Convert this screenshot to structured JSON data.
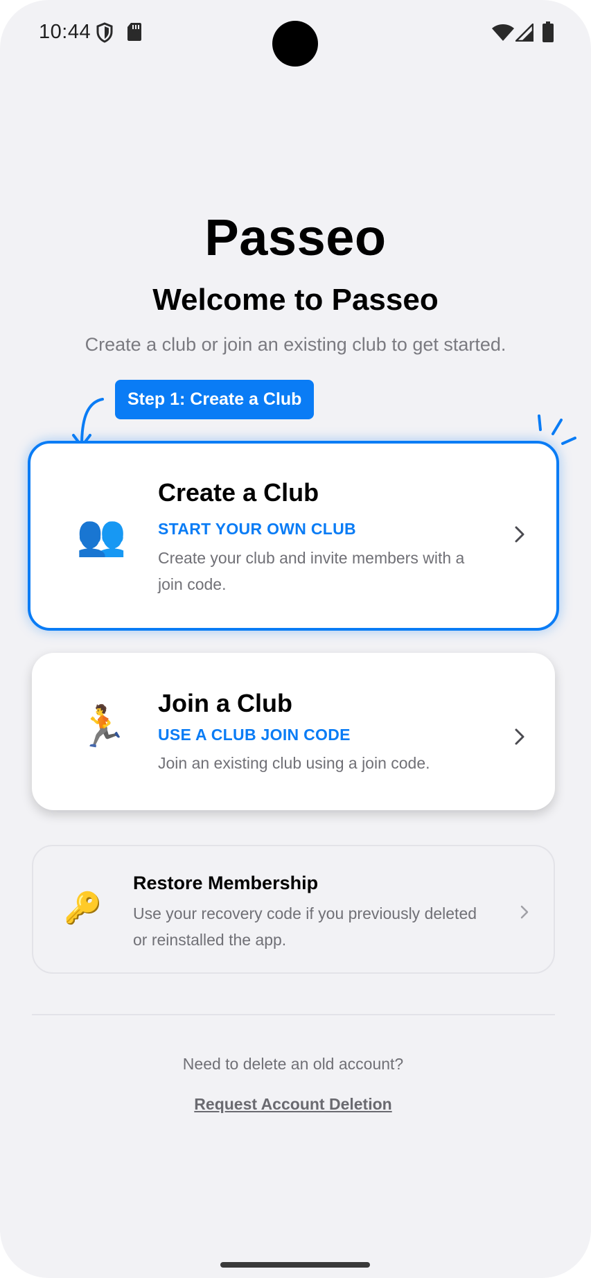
{
  "status_bar": {
    "time": "10:44",
    "icons": [
      "shield-icon",
      "sd-card-icon",
      "wifi-icon",
      "signal-icon",
      "battery-icon"
    ]
  },
  "header": {
    "app_title": "Passeo",
    "welcome": "Welcome to Passeo",
    "subtitle": "Create a club or join an existing club to get started."
  },
  "step_badge": "Step 1: Create a Club",
  "cards": {
    "create": {
      "icon": "👥",
      "icon_name": "people-icon",
      "title": "Create a Club",
      "tagline": "START YOUR OWN CLUB",
      "description": "Create your club and invite members with a join code."
    },
    "join": {
      "icon": "🏃",
      "icon_name": "runner-icon",
      "title": "Join a Club",
      "tagline": "USE A CLUB JOIN CODE",
      "description": "Join an existing club using a join code."
    },
    "restore": {
      "icon": "🔑",
      "icon_name": "key-icon",
      "title": "Restore Membership",
      "description": "Use your recovery code if you previously deleted or reinstalled the app."
    }
  },
  "footer": {
    "question": "Need to delete an old account?",
    "link": "Request Account Deletion"
  },
  "colors": {
    "accent": "#0a7cf5",
    "background": "#f2f2f5",
    "muted_text": "#707076"
  }
}
